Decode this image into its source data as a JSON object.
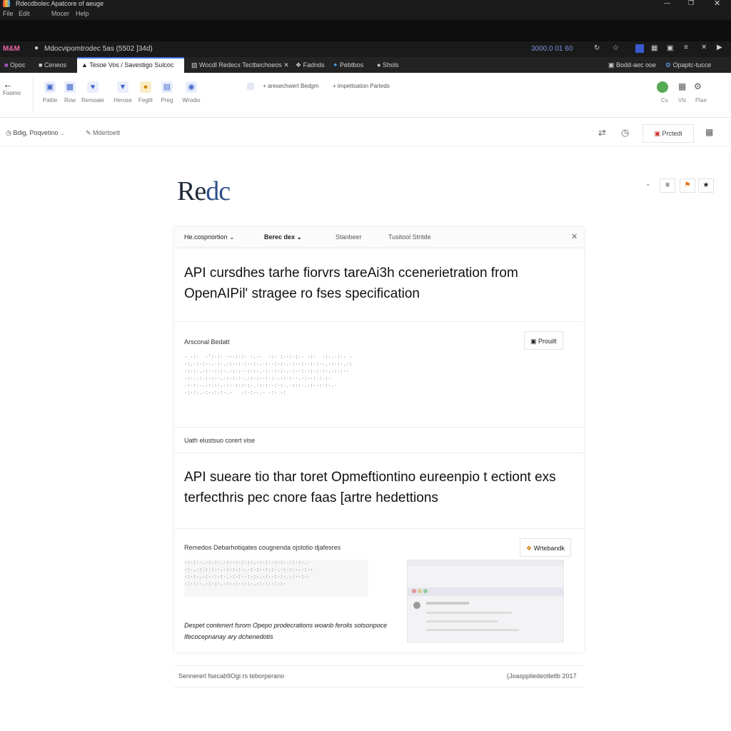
{
  "window": {
    "title": "Rdecdbolec Apatcore of aeuge",
    "menu": [
      "File",
      "Edit",
      "Mocer",
      "Help"
    ]
  },
  "address": {
    "site_label": "M&M",
    "url": "Mdocvipomtrodec 5as (5502 ]34d)",
    "counter": "3000.0 01 60"
  },
  "tabs": [
    {
      "label": "Opoc"
    },
    {
      "label": "Ceneos"
    },
    {
      "label": "Tesoe Vos / Savestigo Sulcoc"
    },
    {
      "label": "Wocdl Redecx Tectbechoeos"
    },
    {
      "label": "Fadnds"
    },
    {
      "label": "Pebtbos"
    },
    {
      "label": "Shols"
    },
    {
      "label": "Bodd-aec ooe"
    },
    {
      "label": "Opaptc-tucce"
    }
  ],
  "ribbon": {
    "back_label": "Foomo",
    "buttons": [
      "Pattie",
      "Row",
      "Remoaie",
      "Herose",
      "Fegitt",
      "Preg",
      "Wrodio"
    ],
    "center_items": [
      "aresechwert Bedgm",
      "impettsation Parteds"
    ],
    "right_labels": [
      "Cs",
      "Vls",
      "Plae"
    ]
  },
  "subbar": {
    "dropdown": "Bdig, Poqvetino",
    "link": "Mdertoett",
    "button": "Prctedi"
  },
  "logo": {
    "main": "Re",
    "accent": "dc"
  },
  "panel_tabs": [
    "He.cospnortion",
    "Berec dex",
    "Stanbeer",
    "Tusitool Stritde"
  ],
  "section1": {
    "heading": "API cursdhes tarhe fiorvrs tareAi3h ccenerietration from OpenAIPil' stragee ro fses specification",
    "label": "Arsconal Bedatt",
    "button": "Prouilt"
  },
  "section2": {
    "label": "Uath elustsuo corert vise",
    "heading": "API sueare tio thar toret Opmeftiontino eureenpio t ectiont exs terfecthris pec cnore faas [artre hedettions"
  },
  "section3": {
    "label": "Remedos Debarhotiqates cougnenda ojstotio djafesres",
    "button": "Wrtebandk",
    "italic_text": "Despet contenert fsrom Opepo prodecrations woanb ferolis sotsonpoce Ifecocepnanay ary dchenedotis"
  },
  "footer": {
    "left": "Sennererl fsecab9Ogi rs teborperano",
    "right": "(Joasppliedeotletlb 2017"
  }
}
